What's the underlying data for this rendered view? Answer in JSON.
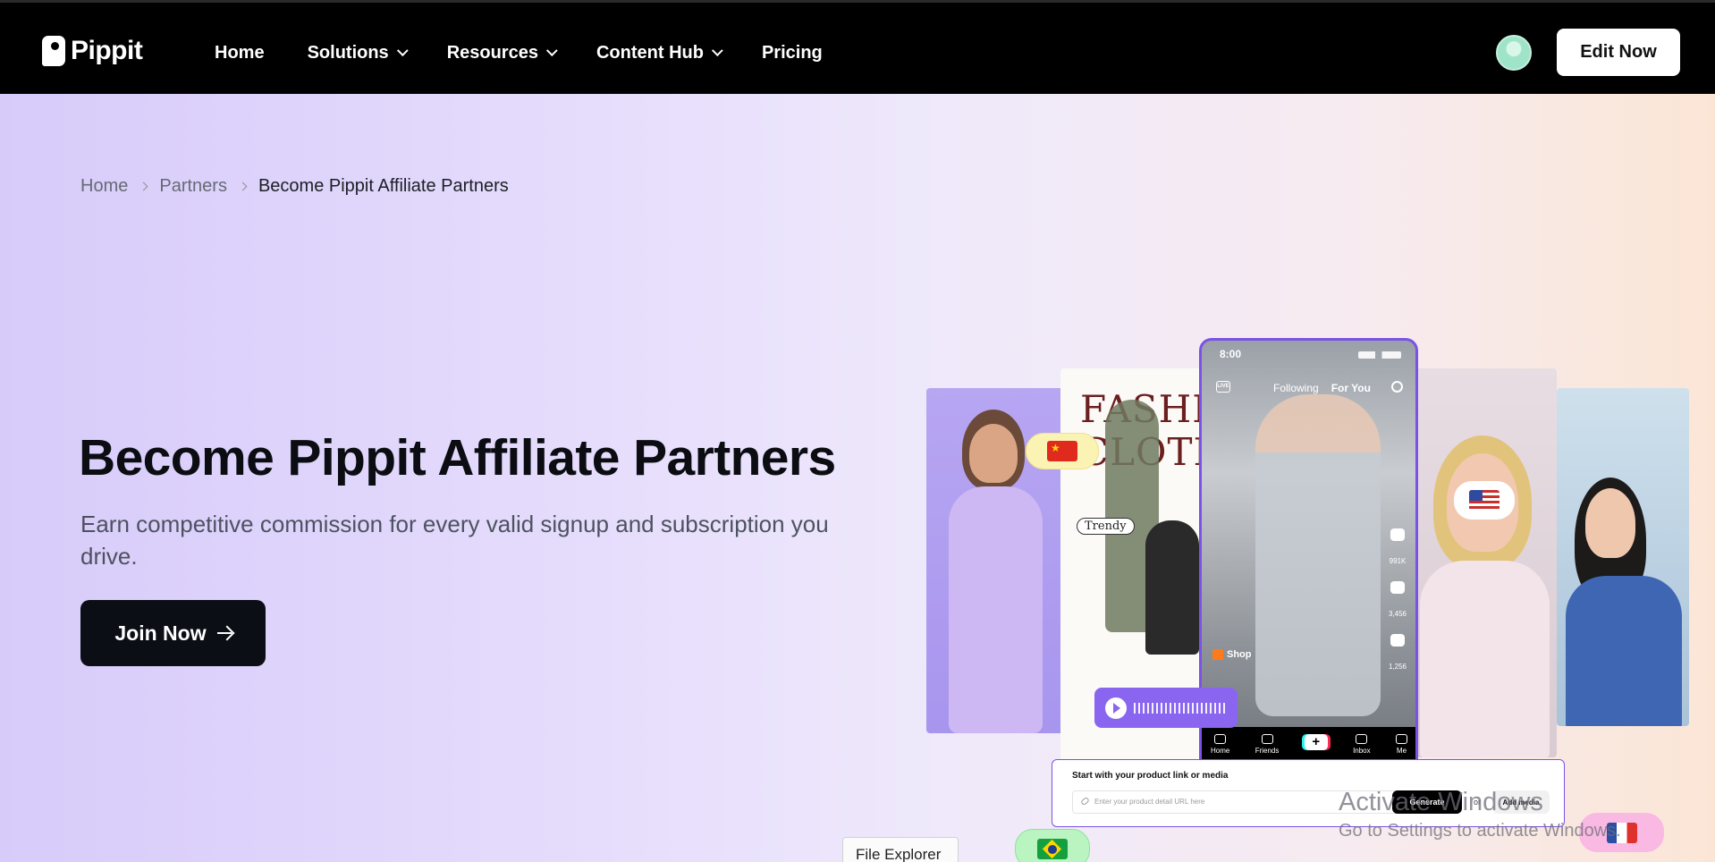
{
  "header": {
    "logo_text": "Pippit",
    "nav": [
      {
        "label": "Home",
        "has_dropdown": false
      },
      {
        "label": "Solutions",
        "has_dropdown": true
      },
      {
        "label": "Resources",
        "has_dropdown": true
      },
      {
        "label": "Content Hub",
        "has_dropdown": true
      },
      {
        "label": "Pricing",
        "has_dropdown": false
      }
    ],
    "edit_button": "Edit Now"
  },
  "breadcrumb": {
    "items": [
      "Home",
      "Partners",
      "Become Pippit Affiliate Partners"
    ]
  },
  "hero": {
    "title": "Become Pippit Affiliate Partners",
    "subtitle": "Earn competitive commission for every valid signup and subscription you drive.",
    "cta": "Join Now"
  },
  "collage": {
    "fashion_word": "FASHION CLOTH",
    "trendy_tag": "Trendy",
    "phone": {
      "time": "8:00",
      "live": "LIVE",
      "tabs": [
        "Following",
        "For You"
      ],
      "likes": "991K",
      "comments": "3,456",
      "saves": "1,256",
      "shop": "Shop",
      "bottom_tabs": [
        "Home",
        "Friends",
        "+",
        "Inbox",
        "Me"
      ]
    },
    "prompt": {
      "title": "Start with your product link or media",
      "placeholder": "Enter your product detail URL here",
      "generate": "Generate",
      "or": "or",
      "add_media": "Add media"
    },
    "flags": [
      "flag-china",
      "flag-usa",
      "flag-brazil",
      "flag-france"
    ]
  },
  "overlay": {
    "activate_title": "Activate Windows",
    "activate_sub": "Go to Settings to activate Windows.",
    "tooltip": "File Explorer"
  }
}
